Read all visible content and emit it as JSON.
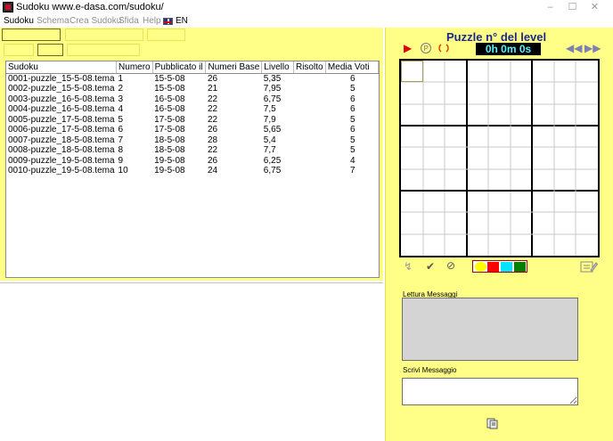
{
  "window": {
    "title": "Sudoku www.e-dasa.com/sudoku/",
    "controls": {
      "minimize": "–",
      "maximize": "☐",
      "close": "✕"
    }
  },
  "menu": {
    "items": [
      "Sudoku",
      "Schema",
      "Crea Sudoku",
      "Sfida",
      "Help"
    ],
    "language": "EN"
  },
  "table": {
    "columns": [
      "Sudoku",
      "Numero",
      "Pubblicato il",
      "Numeri Base",
      "Livello",
      "Risolto",
      "Media Voti"
    ],
    "rows": [
      [
        "0001-puzzle_15-5-08.tema",
        "1",
        "15-5-08",
        "26",
        "5,35",
        "",
        "6"
      ],
      [
        "0002-puzzle_15-5-08.tema",
        "2",
        "15-5-08",
        "21",
        "7,95",
        "",
        "5"
      ],
      [
        "0003-puzzle_16-5-08.tema",
        "3",
        "16-5-08",
        "22",
        "6,75",
        "",
        "6"
      ],
      [
        "0004-puzzle_16-5-08.tema",
        "4",
        "16-5-08",
        "22",
        "7,5",
        "",
        "6"
      ],
      [
        "0005-puzzle_17-5-08.tema",
        "5",
        "17-5-08",
        "22",
        "7,9",
        "",
        "5"
      ],
      [
        "0006-puzzle_17-5-08.tema",
        "6",
        "17-5-08",
        "26",
        "5,65",
        "",
        "6"
      ],
      [
        "0007-puzzle_18-5-08.tema",
        "7",
        "18-5-08",
        "28",
        "5,4",
        "",
        "5"
      ],
      [
        "0008-puzzle_18-5-08.tema",
        "8",
        "18-5-08",
        "22",
        "7,7",
        "",
        "5"
      ],
      [
        "0009-puzzle_19-5-08.tema",
        "9",
        "19-5-08",
        "26",
        "6,25",
        "",
        "4"
      ],
      [
        "0010-puzzle_19-5-08.tema",
        "10",
        "19-5-08",
        "24",
        "6,75",
        "",
        "7"
      ]
    ]
  },
  "puzzle": {
    "title": "Puzzle n° del  level",
    "timer": "0h 0m 0s",
    "icons": {
      "play": "play-icon",
      "pause": "pause-icon",
      "reset": "reset-icon",
      "prev": "rewind-icon",
      "next": "fast-forward-icon",
      "hint": "hint-icon",
      "check": "check-icon",
      "clear": "no-entry-icon",
      "edit": "edit-icon"
    },
    "palette_colors": [
      "#ffff00",
      "#ff0000",
      "#00e5ff",
      "#008000"
    ],
    "accent": "#1a2a8a"
  },
  "messages": {
    "read_label": "Lettura Messaggi",
    "write_label": "Scrivi Messaggio",
    "send_icon": "send-icon"
  },
  "colors": {
    "panel_yellow": "#ffff88",
    "timer_bg": "#000000",
    "timer_fg": "#56f3ff"
  }
}
